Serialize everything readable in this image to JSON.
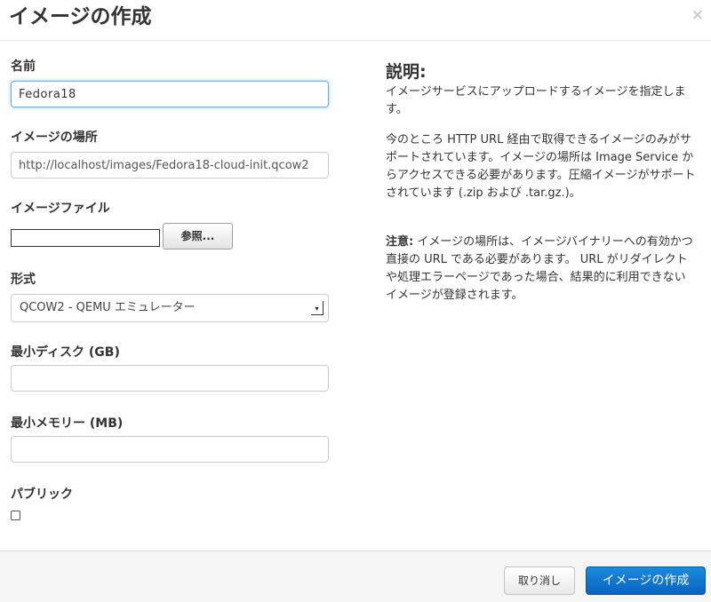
{
  "modal": {
    "title": "イメージの作成",
    "close_glyph": "×"
  },
  "form": {
    "name": {
      "label": "名前",
      "value": "Fedora18"
    },
    "location": {
      "label": "イメージの場所",
      "value": "http://localhost/images/Fedora18-cloud-init.qcow2"
    },
    "file": {
      "label": "イメージファイル",
      "browse_label": "参照..."
    },
    "format": {
      "label": "形式",
      "selected": "QCOW2 - QEMU エミュレーター"
    },
    "min_disk": {
      "label": "最小ディスク (GB)",
      "value": ""
    },
    "min_ram": {
      "label": "最小メモリー (MB)",
      "value": ""
    },
    "public": {
      "label": "パブリック",
      "checked": false
    }
  },
  "help": {
    "title": "説明:",
    "p1": "イメージサービスにアップロードするイメージを指定します。",
    "p2": "今のところ HTTP URL 経由で取得できるイメージのみがサポートされています。イメージの場所は Image Service からアクセスできる必要があります。圧縮イメージがサポートされています (.zip および .tar.gz.)。",
    "note_label": "注意:",
    "note_text": " イメージの場所は、イメージバイナリーへの有効かつ直接の URL である必要があります。 URL がリダイレクトや処理エラーページであった場合、結果的に利用できないイメージが登録されます。"
  },
  "footer": {
    "cancel_label": "取り消し",
    "submit_label": "イメージの作成"
  },
  "colors": {
    "primary": "#0a63c2",
    "focus": "#66afe9",
    "footer_bg": "#f5f5f5"
  }
}
